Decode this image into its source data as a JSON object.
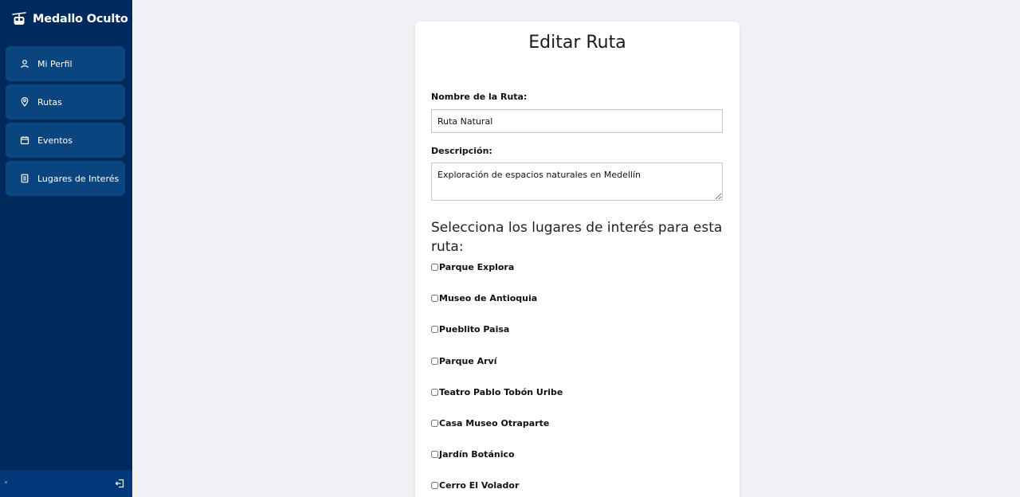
{
  "app": {
    "title": "Medallo Oculto",
    "brand_icon": "cable-car-icon"
  },
  "sidebar": {
    "items": [
      {
        "label": "Mi Perfil",
        "icon": "user-icon"
      },
      {
        "label": "Rutas",
        "icon": "map-pin-icon"
      },
      {
        "label": "Eventos",
        "icon": "calendar-icon"
      },
      {
        "label": "Lugares de Interés",
        "icon": "document-icon"
      }
    ],
    "logout_icon": "logout-icon"
  },
  "form": {
    "title": "Editar Ruta",
    "name_label": "Nombre de la Ruta:",
    "name_value": "Ruta Natural",
    "description_label": "Descripción:",
    "description_value": "Exploración de espacios naturales en Medellín",
    "places_heading": "Selecciona los lugares de interés para esta ruta:",
    "places": [
      {
        "label": "Parque Explora",
        "checked": false
      },
      {
        "label": "Museo de Antioquia",
        "checked": false
      },
      {
        "label": "Pueblito Paisa",
        "checked": false
      },
      {
        "label": "Parque Arví",
        "checked": false
      },
      {
        "label": "Teatro Pablo Tobón Uribe",
        "checked": false
      },
      {
        "label": "Casa Museo Otraparte",
        "checked": false
      },
      {
        "label": "Jardín Botánico",
        "checked": false
      },
      {
        "label": "Cerro El Volador",
        "checked": false
      }
    ]
  },
  "colors": {
    "sidebar_bg": "#002a5c",
    "nav_item_bg": "#0b4580",
    "page_bg": "#f0f1f5",
    "card_bg": "#ffffff"
  }
}
